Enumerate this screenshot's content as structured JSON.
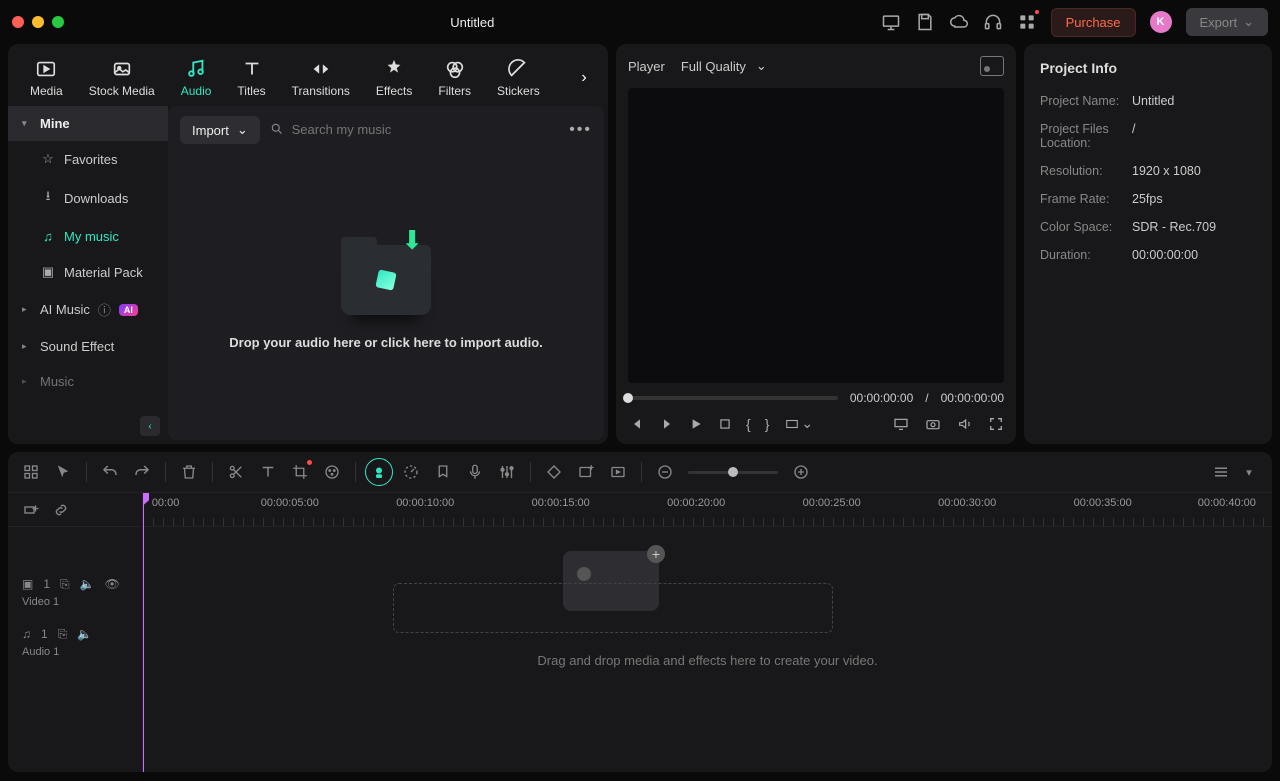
{
  "titlebar": {
    "title": "Untitled",
    "purchase": "Purchase",
    "export": "Export",
    "avatar_initial": "K"
  },
  "tabs": {
    "items": [
      "Media",
      "Stock Media",
      "Audio",
      "Titles",
      "Transitions",
      "Effects",
      "Filters",
      "Stickers"
    ],
    "active_index": 2
  },
  "sidebar": {
    "groups": [
      {
        "label": "Mine",
        "expandable": true,
        "top": true
      },
      {
        "label": "Favorites",
        "icon": "star"
      },
      {
        "label": "Downloads",
        "icon": "download"
      },
      {
        "label": "My music",
        "icon": "music",
        "active": true
      },
      {
        "label": "Material Pack",
        "icon": "pack"
      },
      {
        "label": "AI Music",
        "expandable": true,
        "ai": true,
        "ai_badge": "AI"
      },
      {
        "label": "Sound Effect",
        "expandable": true
      },
      {
        "label": "Music",
        "expandable": true,
        "dim": true
      }
    ]
  },
  "content": {
    "import_label": "Import",
    "search_placeholder": "Search my music",
    "drop_text": "Drop your audio here or click here to import audio."
  },
  "player": {
    "label": "Player",
    "quality": "Full Quality",
    "current_time": "00:00:00:00",
    "separator": "/",
    "total_time": "00:00:00:00"
  },
  "project_info": {
    "title": "Project Info",
    "rows": [
      {
        "label": "Project Name:",
        "value": "Untitled"
      },
      {
        "label": "Project Files Location:",
        "value": "/"
      },
      {
        "label": "Resolution:",
        "value": "1920 x 1080"
      },
      {
        "label": "Frame Rate:",
        "value": "25fps"
      },
      {
        "label": "Color Space:",
        "value": "SDR - Rec.709"
      },
      {
        "label": "Duration:",
        "value": "00:00:00:00"
      }
    ]
  },
  "timeline": {
    "ruler": [
      "00:00",
      "00:00:05:00",
      "00:00:10:00",
      "00:00:15:00",
      "00:00:20:00",
      "00:00:25:00",
      "00:00:30:00",
      "00:00:35:00",
      "00:00:40:00"
    ],
    "tracks": [
      {
        "name": "Video 1",
        "type": "video",
        "index": "1"
      },
      {
        "name": "Audio 1",
        "type": "audio",
        "index": "1"
      }
    ],
    "drop_hint": "Drag and drop media and effects here to create your video."
  }
}
